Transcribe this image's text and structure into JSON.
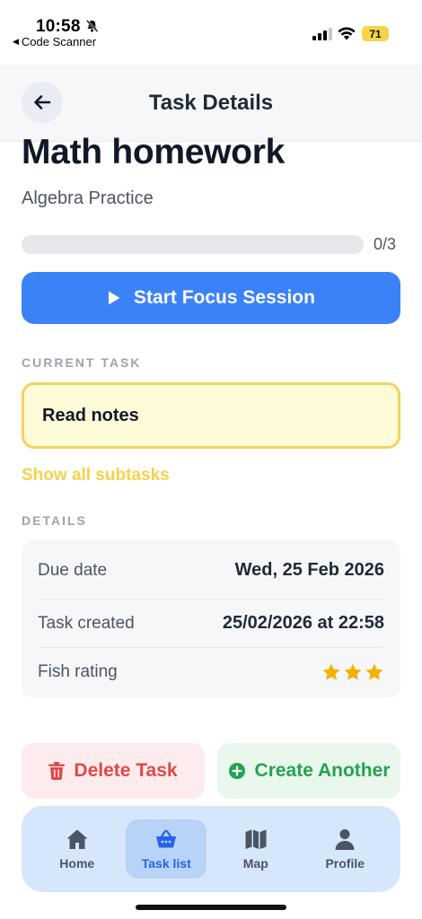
{
  "status_bar": {
    "time": "10:58",
    "back_app": "Code Scanner",
    "battery": "71"
  },
  "header": {
    "title": "Task Details"
  },
  "task": {
    "title": "Math homework",
    "subtitle": "Algebra Practice",
    "progress_text": "0/3",
    "progress_fraction": 0
  },
  "focus_button": {
    "label": "Start Focus Session"
  },
  "current_task": {
    "section_label": "CURRENT TASK",
    "text": "Read notes"
  },
  "show_subtasks_label": "Show all subtasks",
  "details": {
    "section_label": "DETAILS",
    "rows": [
      {
        "label": "Due date",
        "value": "Wed, 25 Feb 2026"
      },
      {
        "label": "Task created",
        "value": "25/02/2026 at 22:58"
      },
      {
        "label": "Fish rating",
        "stars": 3
      }
    ]
  },
  "actions": {
    "delete_label": "Delete Task",
    "create_label": "Create Another"
  },
  "nav": {
    "items": [
      {
        "label": "Home",
        "icon": "home-icon"
      },
      {
        "label": "Task list",
        "icon": "basket-icon",
        "active": true
      },
      {
        "label": "Map",
        "icon": "map-icon"
      },
      {
        "label": "Profile",
        "icon": "person-icon"
      }
    ]
  },
  "colors": {
    "accent": "#3b82f6",
    "current_task_bg": "#fefbd9",
    "current_task_border": "#f4d35e",
    "subtasks_link": "#f6d24a",
    "delete": "#e04848",
    "create": "#23a350",
    "star": "#f5b000",
    "nav_bg": "#d6e6fb"
  }
}
